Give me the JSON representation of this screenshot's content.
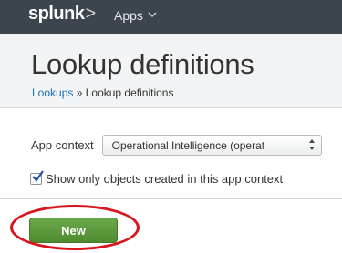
{
  "topbar": {
    "logo_text": "splunk",
    "logo_suffix": ">",
    "apps_label": "Apps",
    "apps_icon": "chevron-down-icon"
  },
  "page": {
    "title": "Lookup definitions",
    "breadcrumb_link": "Lookups",
    "breadcrumb_separator": " » ",
    "breadcrumb_current": "Lookup definitions"
  },
  "filters": {
    "app_context_label": "App context",
    "app_context_value": "Operational Intelligence (operat",
    "show_only_label": "Show only objects created in this app context",
    "show_only_checked": true
  },
  "actions": {
    "new_label": "New"
  },
  "annotation": {
    "highlight_color": "#d8151c"
  }
}
